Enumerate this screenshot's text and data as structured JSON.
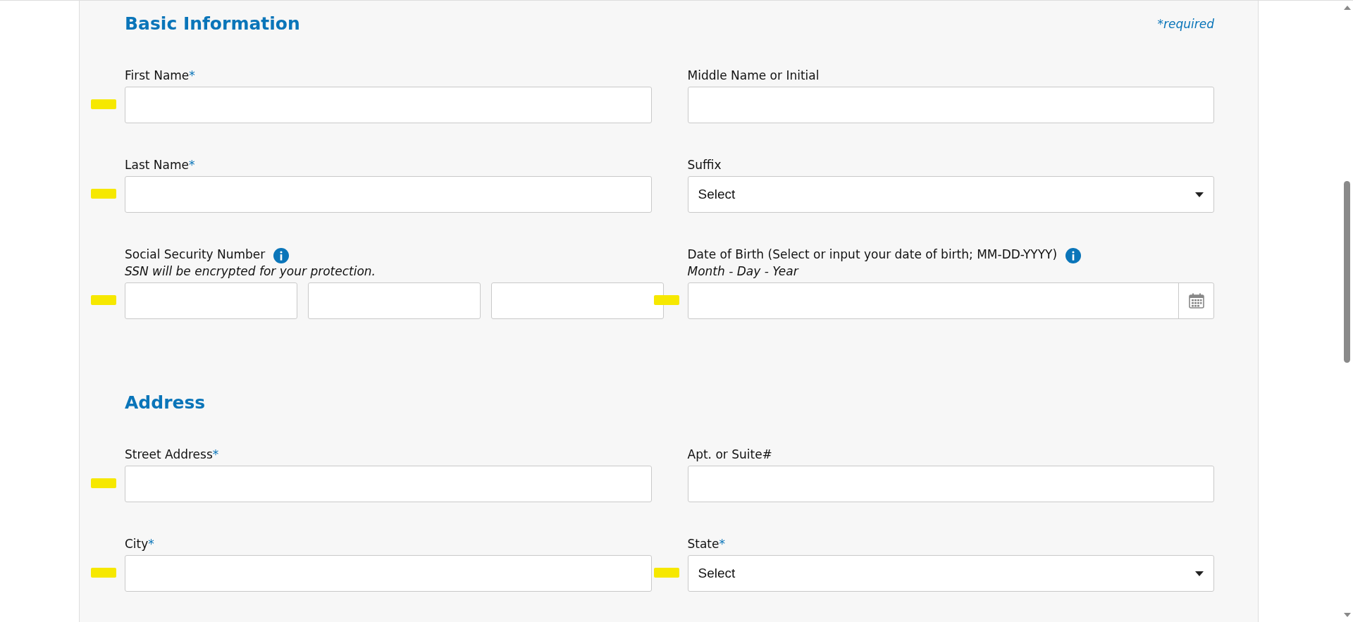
{
  "sections": [
    {
      "title": "Basic Information",
      "note": "*required",
      "fields": [
        {
          "kind": "text",
          "label": "First Name",
          "required_mark": "*",
          "highlighted": true
        },
        {
          "kind": "text",
          "label": "Middle Name or Initial",
          "highlighted": false
        },
        {
          "kind": "text",
          "label": "Last Name",
          "required_mark": "*",
          "highlighted": true
        },
        {
          "kind": "select",
          "label": "Suffix",
          "value": "Select",
          "highlighted": false
        },
        {
          "kind": "ssn",
          "label": "Social Security Number",
          "info": true,
          "hint": "SSN will be encrypted for your protection.",
          "highlighted": true
        },
        {
          "kind": "date",
          "label": "Date of Birth (Select or input your date of birth; MM-DD-YYYY)",
          "info": true,
          "hint": "Month - Day - Year",
          "highlighted": true
        }
      ]
    },
    {
      "title": "Address",
      "fields": [
        {
          "kind": "text",
          "label": "Street Address",
          "required_mark": "*",
          "highlighted": true
        },
        {
          "kind": "text",
          "label": "Apt. or Suite#",
          "highlighted": false
        },
        {
          "kind": "text",
          "label": "City",
          "required_mark": "*",
          "highlighted": true
        },
        {
          "kind": "select",
          "label": "State",
          "required_mark": "*",
          "value": "Select",
          "highlighted": true
        }
      ]
    }
  ]
}
